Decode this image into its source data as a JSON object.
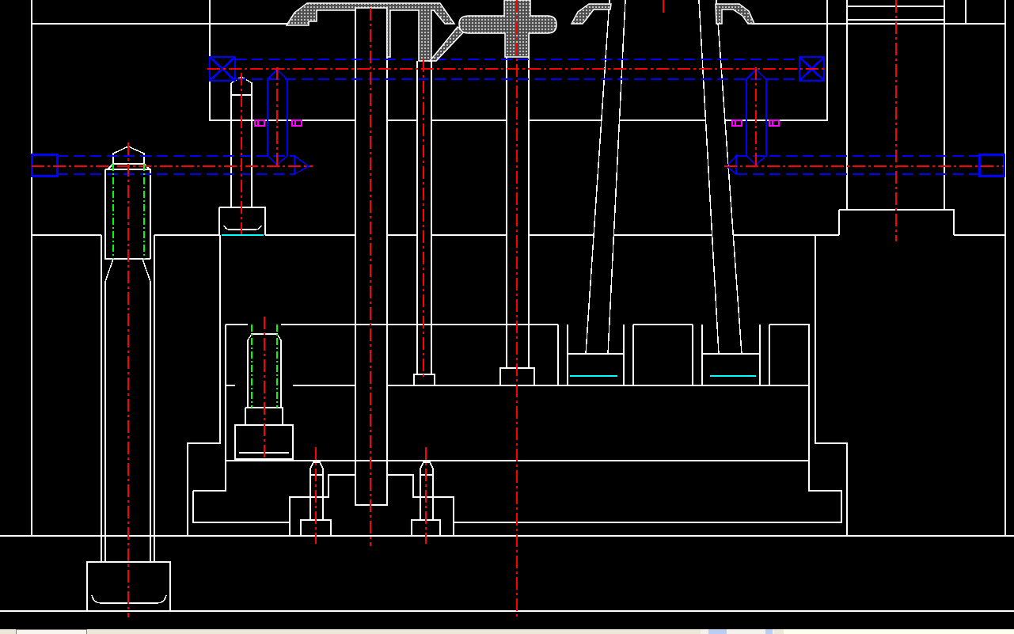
{
  "drawing": {
    "layers": [
      {
        "kind": "outline",
        "color": "#ffffff"
      },
      {
        "kind": "centerline",
        "color": "#ff0000"
      },
      {
        "kind": "hidden",
        "color": "#0000ff"
      },
      {
        "kind": "thread",
        "color": "#00ff00"
      },
      {
        "kind": "seal",
        "color": "#ff00ff"
      },
      {
        "kind": "seat",
        "color": "#00ffff"
      },
      {
        "kind": "hatch",
        "color": "#c0c0c0"
      }
    ]
  }
}
